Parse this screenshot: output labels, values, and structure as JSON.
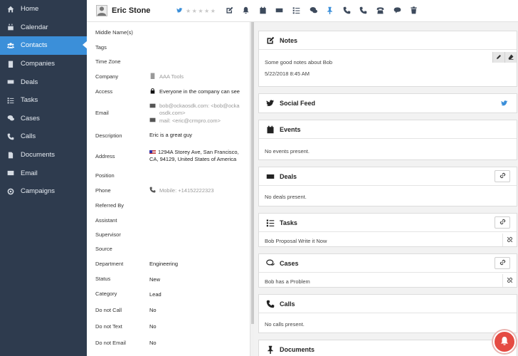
{
  "sidebar": {
    "items": [
      {
        "label": "Home",
        "icon": "home-icon"
      },
      {
        "label": "Calendar",
        "icon": "calendar-icon"
      },
      {
        "label": "Contacts",
        "icon": "contacts-icon",
        "active": true
      },
      {
        "label": "Companies",
        "icon": "building-icon"
      },
      {
        "label": "Deals",
        "icon": "money-icon"
      },
      {
        "label": "Tasks",
        "icon": "tasks-icon"
      },
      {
        "label": "Cases",
        "icon": "chat-icon"
      },
      {
        "label": "Calls",
        "icon": "phone-icon"
      },
      {
        "label": "Documents",
        "icon": "document-icon"
      },
      {
        "label": "Email",
        "icon": "envelope-icon"
      },
      {
        "label": "Campaigns",
        "icon": "target-icon"
      }
    ]
  },
  "header": {
    "title": "Eric Stone",
    "rating": 0,
    "rating_max": 5
  },
  "details": {
    "middle_name_label": "Middle Name(s)",
    "tags_label": "Tags",
    "time_zone_label": "Time Zone",
    "company_label": "Company",
    "company_value": "AAA Tools",
    "access_label": "Access",
    "access_value": "Everyone in the company can see",
    "email_label": "Email",
    "email_1": "bob@ockaosdk.com: <bob@ockaosdk.com>",
    "email_2": "mail: <eric@crmpro.com>",
    "description_label": "Description",
    "description_value": "Eric is a great guy",
    "address_label": "Address",
    "address_value": "1294A Storey Ave, San Francisco, CA, 94129, United States of America",
    "position_label": "Position",
    "phone_label": "Phone",
    "phone_value": "Mobile: +14152222323",
    "referred_by_label": "Referred By",
    "assistant_label": "Assistant",
    "supervisor_label": "Supervisor",
    "source_label": "Source",
    "department_label": "Department",
    "department_value": "Engineering",
    "status_label": "Status",
    "status_value": "New",
    "category_label": "Category",
    "category_value": "Lead",
    "do_not_call_label": "Do not Call",
    "do_not_call_value": "No",
    "do_not_text_label": "Do not Text",
    "do_not_text_value": "No",
    "do_not_email_label": "Do not Email",
    "do_not_email_value": "No"
  },
  "cards": {
    "notes": {
      "title": "Notes",
      "text": "Some good notes about Bob",
      "date": "5/22/2018 8:45 AM"
    },
    "social": {
      "title": "Social Feed"
    },
    "events": {
      "title": "Events",
      "empty": "No events present."
    },
    "deals": {
      "title": "Deals",
      "empty": "No deals present."
    },
    "tasks": {
      "title": "Tasks",
      "item": "Bob Proposal Write it Now"
    },
    "cases": {
      "title": "Cases",
      "item": "Bob has a Problem"
    },
    "calls": {
      "title": "Calls",
      "empty": "No calls present."
    },
    "documents": {
      "title": "Documents"
    }
  },
  "colors": {
    "sidebar_bg": "#2e3b4e",
    "accent": "#3b8fd9",
    "notification": "#e54b43"
  }
}
